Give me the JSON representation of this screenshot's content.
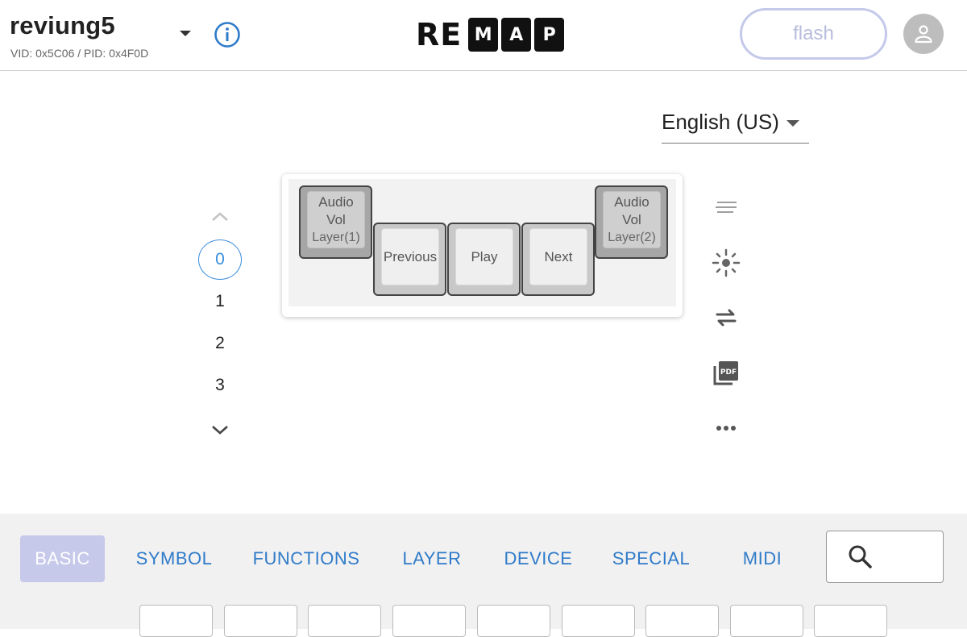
{
  "header": {
    "keyboard_name": "reviung5",
    "ids": "VID: 0x5C06 / PID: 0x4F0D",
    "logo_plain": "RE",
    "logo_boxes": [
      "M",
      "A",
      "P"
    ],
    "flash_label": "flash"
  },
  "language": {
    "selected": "English (US)"
  },
  "layers": {
    "items": [
      "0",
      "1",
      "2",
      "3"
    ],
    "active": "0"
  },
  "keymap": {
    "keys": [
      {
        "label": "Audio Vol",
        "sub": "Layer(1)"
      },
      {
        "label": "Previous",
        "sub": ""
      },
      {
        "label": "Play",
        "sub": ""
      },
      {
        "label": "Next",
        "sub": ""
      },
      {
        "label": "Audio Vol",
        "sub": "Layer(2)"
      }
    ]
  },
  "palette": {
    "tabs": [
      "BASIC",
      "SYMBOL",
      "FUNCTIONS",
      "LAYER",
      "DEVICE",
      "SPECIAL",
      "MIDI"
    ],
    "active_tab": "BASIC"
  },
  "colors": {
    "accent_blue": "#2f7bc9",
    "flash_border": "#c5c9ea",
    "active_tab_bg": "#c6c9ea"
  },
  "icons": {
    "info": "info-icon",
    "account": "account-icon",
    "search": "search-icon"
  }
}
